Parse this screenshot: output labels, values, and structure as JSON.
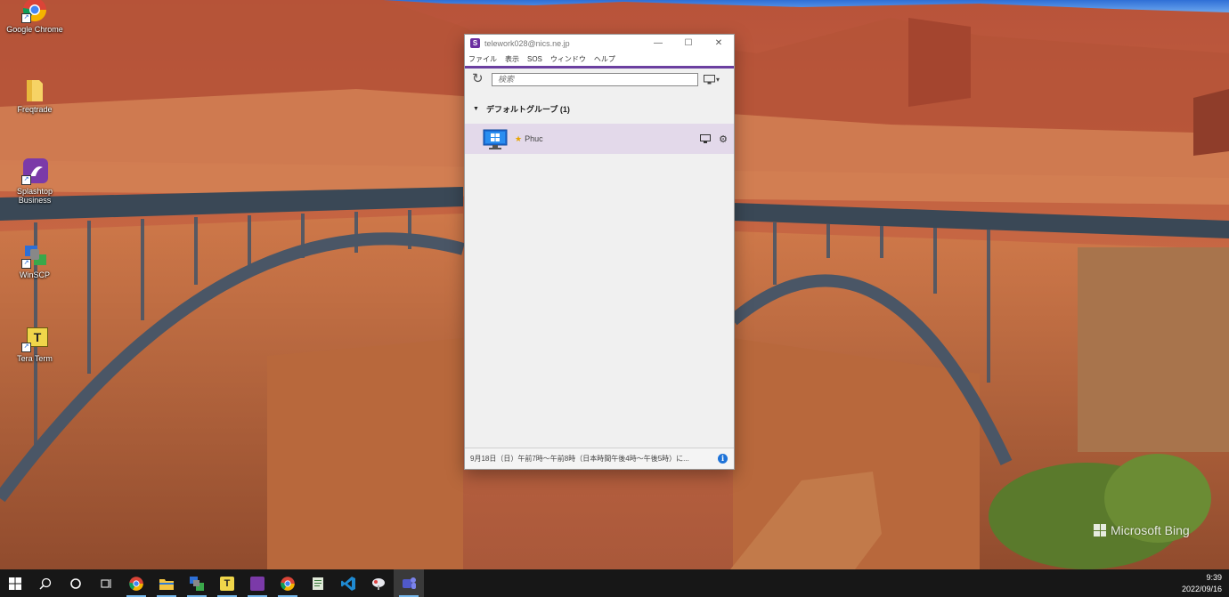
{
  "desktop": {
    "icons": [
      {
        "label": "Google Chrome",
        "icon": "chrome-icon"
      },
      {
        "label": "Freqtrade",
        "icon": "folder-icon"
      },
      {
        "label": "Splashtop Business",
        "icon": "splashtop-icon"
      },
      {
        "label": "WinSCP",
        "icon": "winscp-icon"
      },
      {
        "label": "Tera Term",
        "icon": "teraterm-icon"
      }
    ],
    "watermark": "Microsoft Bing"
  },
  "window": {
    "title": "telework028@nics.ne.jp",
    "menu": [
      "ファイル",
      "表示",
      "SOS",
      "ウィンドウ",
      "ヘルプ"
    ],
    "search": {
      "placeholder": "検索",
      "value": ""
    },
    "group": {
      "label": "デフォルトグループ (1)"
    },
    "computers": [
      {
        "name": "Phuc",
        "os": "windows",
        "favorite": true
      }
    ],
    "status": "9月18日（日）午前7時〜午前8時（日本時間午後4時〜午後5時）に...",
    "accent_color": "#6b3fa0"
  },
  "taskbar": {
    "items": [
      "start-icon",
      "search-icon",
      "cortana-icon",
      "task-view-icon",
      "chrome-icon",
      "file-explorer-icon",
      "network-app-icon",
      "teraterm-icon",
      "splashtop-icon",
      "chrome-icon",
      "notepad-icon",
      "vscode-icon",
      "cloud-app-icon",
      "teams-icon"
    ],
    "clock": {
      "time": "9:39",
      "date": "2022/09/16"
    }
  }
}
